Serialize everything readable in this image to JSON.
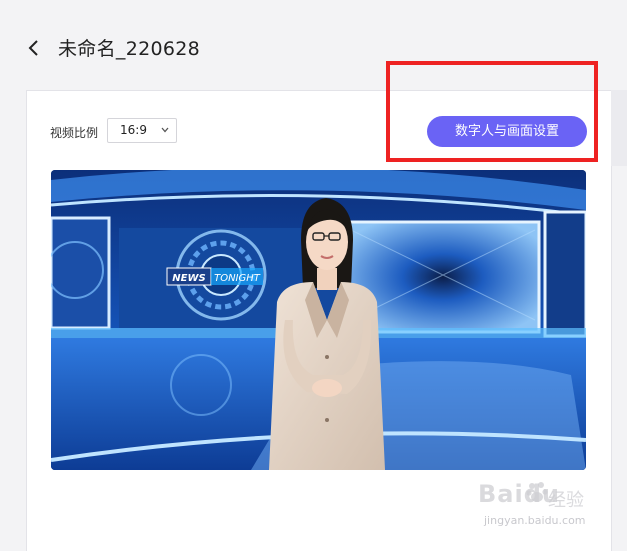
{
  "header": {
    "back_icon": "chevron-left-icon",
    "title": "未命名_220628"
  },
  "toolbar": {
    "ratio_label": "视频比例",
    "ratio_value": "16:9",
    "ratio_icon": "chevron-down-icon",
    "settings_button": "数字人与画面设置",
    "button_color": "#6a63f5"
  },
  "preview": {
    "banner_brand": "NEWS",
    "banner_text": "TONIGHT",
    "avatar": "digital-human-presenter"
  },
  "watermark": {
    "brand": "Baidu",
    "sub": "经验",
    "url": "jingyan.baidu.com"
  },
  "colors": {
    "highlight_box": "#ee2222",
    "background": "#f3f3f5"
  }
}
